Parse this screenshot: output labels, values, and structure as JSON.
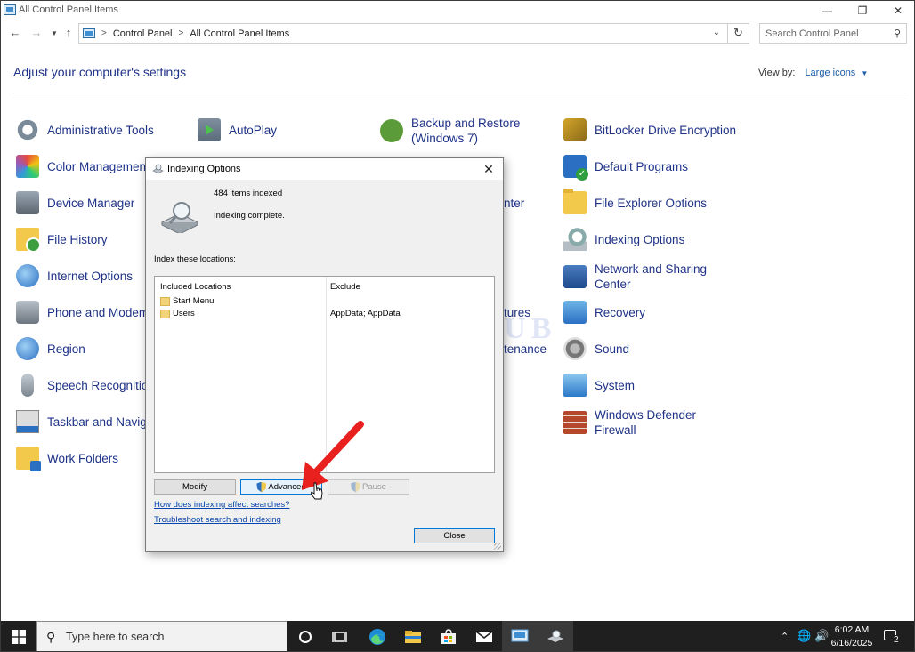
{
  "window": {
    "title": "All Control Panel Items",
    "minimize_icon": "minimize-icon",
    "maximize_icon": "restore-icon",
    "close_icon": "close-icon"
  },
  "nav": {
    "breadcrumb": [
      "Control Panel",
      "All Control Panel Items"
    ],
    "search_placeholder": "Search Control Panel"
  },
  "content": {
    "heading": "Adjust your computer's settings",
    "view_by_label": "View by:",
    "view_by_value": "Large icons"
  },
  "items": {
    "col1": [
      "Administrative Tools",
      "Color Management",
      "Device Manager",
      "File History",
      "Internet Options",
      "Phone and Modem",
      "Region",
      "Speech Recognition",
      "Taskbar and Naviga",
      "Work Folders"
    ],
    "col2": [
      "AutoPlay"
    ],
    "col3_backup": [
      "Backup and Restore",
      "(Windows 7)"
    ],
    "col3_partial": [
      "nter",
      "tures",
      "tenance"
    ],
    "col4": [
      "BitLocker Drive Encryption",
      "Default Programs",
      "File Explorer Options",
      "Indexing Options",
      "Network and Sharing",
      "Center",
      "Recovery",
      "Sound",
      "System",
      "Windows Defender",
      "Firewall"
    ]
  },
  "dialog": {
    "title": "Indexing Options",
    "items_indexed": "484 items indexed",
    "status": "Indexing complete.",
    "index_label": "Index these locations:",
    "col_included": "Included Locations",
    "col_exclude": "Exclude",
    "locations": [
      {
        "name": "Start Menu",
        "exclude": ""
      },
      {
        "name": "Users",
        "exclude": "AppData; AppData"
      }
    ],
    "buttons": {
      "modify": "Modify",
      "advanced": "Advanced",
      "pause": "Pause",
      "close": "Close"
    },
    "links": [
      "How does indexing affect searches?",
      "Troubleshoot search and indexing"
    ]
  },
  "watermark": "IT Pros HUB",
  "taskbar": {
    "search_placeholder": "Type here to search",
    "pinned": [
      "cortana-icon",
      "task-view-icon",
      "edge-icon",
      "file-explorer-icon",
      "store-icon",
      "mail-icon",
      "control-panel-icon",
      "indexing-options-icon"
    ],
    "time": "6:02 AM",
    "date": "6/16/2025",
    "notifications": "2"
  },
  "colors": {
    "link": "#1e3287",
    "accent": "#0078d7",
    "arrow": "#e8201e",
    "taskbar": "#1f1f1f"
  }
}
